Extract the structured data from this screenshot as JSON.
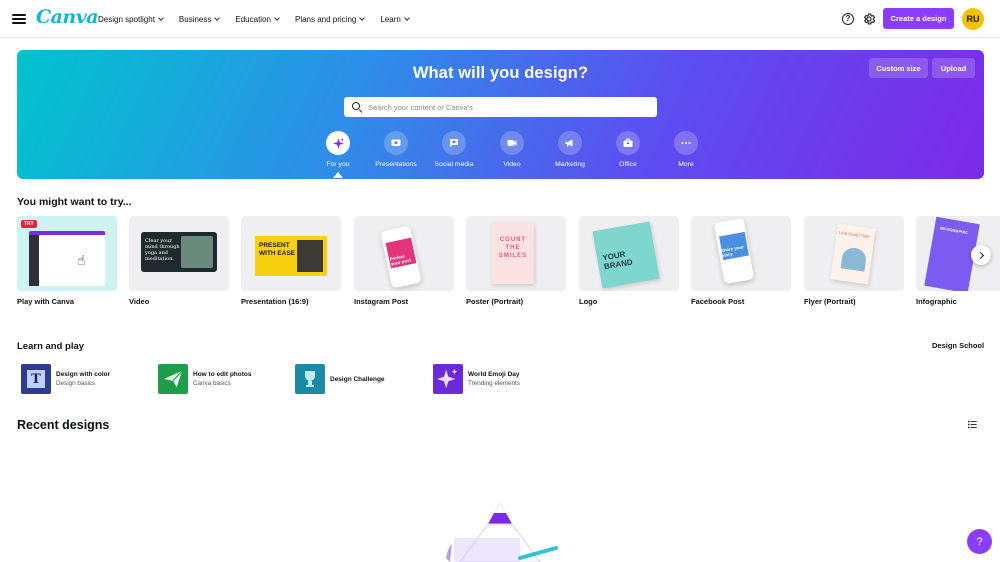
{
  "header": {
    "logo": "Canva",
    "nav": [
      "Design spotlight",
      "Business",
      "Education",
      "Plans and pricing",
      "Learn"
    ],
    "help_glyph": "?",
    "create_label": "Create a design",
    "avatar_initials": "RU"
  },
  "hero": {
    "title": "What will you design?",
    "custom_size_label": "Custom size",
    "upload_label": "Upload",
    "search_placeholder": "Search your content or Canva's",
    "categories": [
      {
        "label": "For you",
        "icon": "sparkle-icon",
        "active": true
      },
      {
        "label": "Presentations",
        "icon": "presentation-icon"
      },
      {
        "label": "Social media",
        "icon": "heart-chat-icon"
      },
      {
        "label": "Video",
        "icon": "video-camera-icon"
      },
      {
        "label": "Marketing",
        "icon": "megaphone-icon"
      },
      {
        "label": "Office",
        "icon": "briefcase-icon"
      },
      {
        "label": "More",
        "icon": "more-icon"
      }
    ]
  },
  "try_section": {
    "title": "You might want to try...",
    "badge": "TRY",
    "cards": [
      {
        "label": "Play with Canva"
      },
      {
        "label": "Video",
        "thumb_text": "Clear your mind through yoga and meditation."
      },
      {
        "label": "Presentation (16:9)",
        "thumb_text": "PRESENT WITH EASE"
      },
      {
        "label": "Instagram Post",
        "thumb_text": "Perfect your post"
      },
      {
        "label": "Poster (Portrait)",
        "thumb_text": "COUNT THE SMILES"
      },
      {
        "label": "Logo",
        "thumb_text": "YOUR BRAND"
      },
      {
        "label": "Facebook Post",
        "thumb_text": "Share your story"
      },
      {
        "label": "Flyer (Portrait)",
        "thumb_text": "LIFE IS BETTER"
      },
      {
        "label": "Infographic",
        "thumb_text": "INFOGRAPHIC"
      }
    ]
  },
  "learn_section": {
    "title": "Learn and play",
    "design_school_label": "Design School",
    "items": [
      {
        "title": "Design with color",
        "subtitle": "Design basics",
        "glyph": "T",
        "color": "#2f3b8c"
      },
      {
        "title": "How to edit photos",
        "subtitle": "Canva basics",
        "glyph": "",
        "color": "#1e9e4a"
      },
      {
        "title": "Design Challenge",
        "subtitle": "",
        "glyph": "",
        "color": "#1b8aa6"
      },
      {
        "title": "World Emoji Day",
        "subtitle": "Trending elements",
        "glyph": "",
        "color": "#6b2bd6"
      }
    ]
  },
  "recent": {
    "title": "Recent designs"
  },
  "help_fab_glyph": "?",
  "colors": {
    "accent": "#8b3dff",
    "logo": "#13b6d1",
    "avatar": "#f2c100"
  }
}
